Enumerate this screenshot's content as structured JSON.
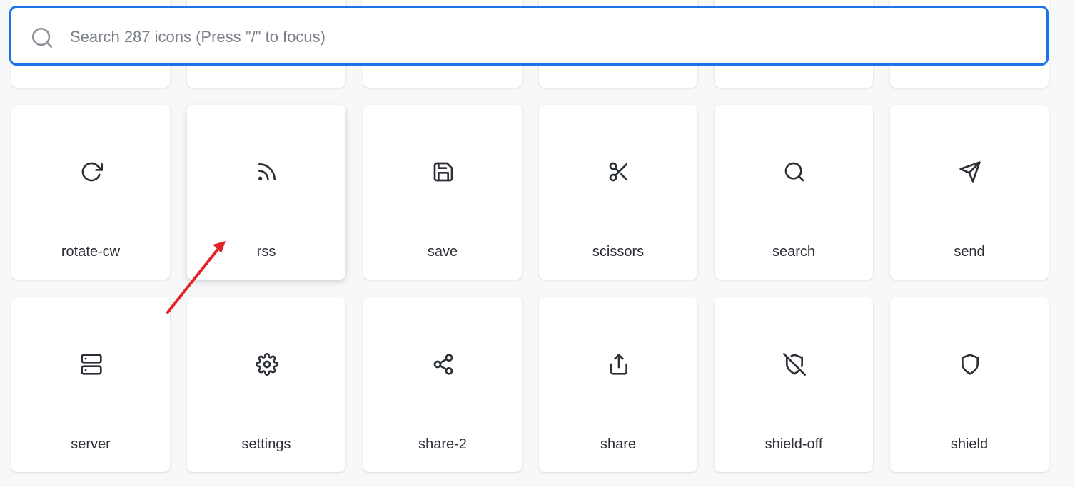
{
  "search": {
    "placeholder": "Search 287 icons (Press \"/\" to focus)",
    "value": ""
  },
  "accent_color": "#1a73e8",
  "annotation_color": "#e0252b",
  "icons": [
    {
      "label": "rotate-cw",
      "icon": "rotate-cw-icon"
    },
    {
      "label": "rss",
      "icon": "rss-icon"
    },
    {
      "label": "save",
      "icon": "save-icon"
    },
    {
      "label": "scissors",
      "icon": "scissors-icon"
    },
    {
      "label": "search",
      "icon": "search-icon"
    },
    {
      "label": "send",
      "icon": "send-icon"
    },
    {
      "label": "server",
      "icon": "server-icon"
    },
    {
      "label": "settings",
      "icon": "settings-icon"
    },
    {
      "label": "share-2",
      "icon": "share-2-icon"
    },
    {
      "label": "share",
      "icon": "share-icon"
    },
    {
      "label": "shield-off",
      "icon": "shield-off-icon"
    },
    {
      "label": "shield",
      "icon": "shield-icon"
    }
  ]
}
